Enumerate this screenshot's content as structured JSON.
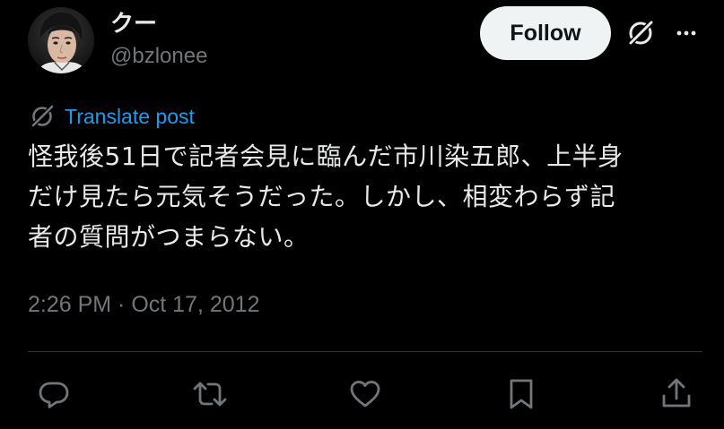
{
  "author": {
    "display_name": "クー",
    "handle": "@bzlonee",
    "avatar_icon": "user-avatar-photo"
  },
  "header": {
    "follow_label": "Follow",
    "grok_icon": "grok-icon",
    "more_icon": "more-options-icon"
  },
  "post": {
    "translate_label": "Translate post",
    "text": "怪我後51日で記者会見に臨んだ市川染五郎、上半身\nだけ見たら元気そうだった。しかし、相変わらず記\n者の質問がつまらない。",
    "timestamp": "2:26 PM · Oct 17, 2012"
  },
  "actions": [
    {
      "name": "reply",
      "icon": "reply-icon"
    },
    {
      "name": "repost",
      "icon": "repost-icon"
    },
    {
      "name": "like",
      "icon": "heart-icon"
    },
    {
      "name": "bookmark",
      "icon": "bookmark-icon"
    },
    {
      "name": "share",
      "icon": "share-icon"
    }
  ],
  "colors": {
    "background": "#000000",
    "text_primary": "#e7e9ea",
    "text_secondary": "#71767b",
    "link": "#1d9bf0",
    "follow_bg": "#eff3f4",
    "divider": "#2f3336"
  }
}
